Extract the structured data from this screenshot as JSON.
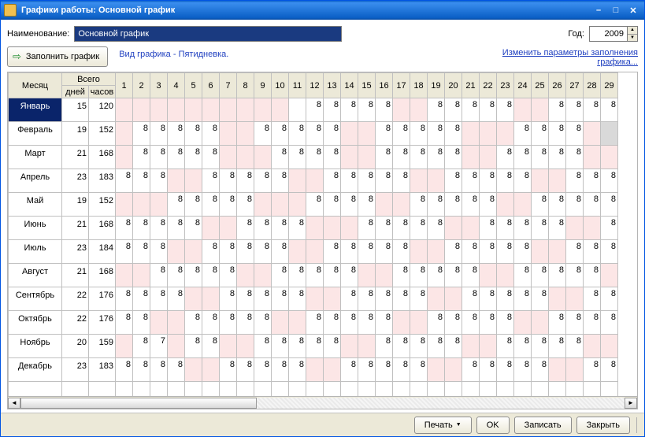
{
  "window": {
    "title": "Графики работы: Основной график"
  },
  "labels": {
    "name": "Наименование:",
    "year": "Год:",
    "fill": "Заполнить график",
    "schedule_type": "Вид графика - Пятидневка.",
    "edit_link": "Изменить параметры заполнения графика...",
    "month_header": "Месяц",
    "total_header": "Всего",
    "days_header": "дней",
    "hours_header": "часов"
  },
  "form": {
    "name_value": "Основной график",
    "year_value": "2009"
  },
  "day_headers": [
    "1",
    "2",
    "3",
    "4",
    "5",
    "6",
    "7",
    "8",
    "9",
    "10",
    "11",
    "12",
    "13",
    "14",
    "15",
    "16",
    "17",
    "18",
    "19",
    "20",
    "21",
    "22",
    "23",
    "24",
    "25",
    "26",
    "27",
    "28",
    "29"
  ],
  "months": [
    {
      "name": "Январь",
      "days": "15",
      "hours": "120",
      "cells": [
        "off",
        "off",
        "off",
        "off",
        "off",
        "off",
        "off",
        "off",
        "off",
        "off",
        "",
        "8",
        "8",
        "8",
        "8",
        "8",
        "off",
        "off",
        "8",
        "8",
        "8",
        "8",
        "8",
        "off",
        "off",
        "8",
        "8",
        "8",
        "8"
      ]
    },
    {
      "name": "Февраль",
      "days": "19",
      "hours": "152",
      "cells": [
        "off",
        "8",
        "8",
        "8",
        "8",
        "8",
        "off",
        "off",
        "8",
        "8",
        "8",
        "8",
        "8",
        "off",
        "off",
        "8",
        "8",
        "8",
        "8",
        "8",
        "off",
        "off",
        "off",
        "8",
        "8",
        "8",
        "8",
        "off",
        "end"
      ]
    },
    {
      "name": "Март",
      "days": "21",
      "hours": "168",
      "cells": [
        "off",
        "8",
        "8",
        "8",
        "8",
        "8",
        "off",
        "off",
        "off",
        "8",
        "8",
        "8",
        "8",
        "off",
        "off",
        "8",
        "8",
        "8",
        "8",
        "8",
        "off",
        "off",
        "8",
        "8",
        "8",
        "8",
        "8",
        "off",
        "off"
      ]
    },
    {
      "name": "Апрель",
      "days": "23",
      "hours": "183",
      "cells": [
        "8",
        "8",
        "8",
        "off",
        "off",
        "8",
        "8",
        "8",
        "8",
        "8",
        "off",
        "off",
        "8",
        "8",
        "8",
        "8",
        "8",
        "off",
        "off",
        "8",
        "8",
        "8",
        "8",
        "8",
        "off",
        "off",
        "8",
        "8",
        "8"
      ]
    },
    {
      "name": "Май",
      "days": "19",
      "hours": "152",
      "cells": [
        "off",
        "off",
        "off",
        "8",
        "8",
        "8",
        "8",
        "8",
        "off",
        "off",
        "off",
        "8",
        "8",
        "8",
        "8",
        "off",
        "off",
        "8",
        "8",
        "8",
        "8",
        "8",
        "off",
        "off",
        "8",
        "8",
        "8",
        "8",
        "8"
      ]
    },
    {
      "name": "Июнь",
      "days": "21",
      "hours": "168",
      "cells": [
        "8",
        "8",
        "8",
        "8",
        "8",
        "off",
        "off",
        "8",
        "8",
        "8",
        "8",
        "off",
        "off",
        "off",
        "8",
        "8",
        "8",
        "8",
        "8",
        "off",
        "off",
        "8",
        "8",
        "8",
        "8",
        "8",
        "off",
        "off",
        "8"
      ]
    },
    {
      "name": "Июль",
      "days": "23",
      "hours": "184",
      "cells": [
        "8",
        "8",
        "8",
        "off",
        "off",
        "8",
        "8",
        "8",
        "8",
        "8",
        "off",
        "off",
        "8",
        "8",
        "8",
        "8",
        "8",
        "off",
        "off",
        "8",
        "8",
        "8",
        "8",
        "8",
        "off",
        "off",
        "8",
        "8",
        "8"
      ]
    },
    {
      "name": "Август",
      "days": "21",
      "hours": "168",
      "cells": [
        "off",
        "off",
        "8",
        "8",
        "8",
        "8",
        "8",
        "off",
        "off",
        "8",
        "8",
        "8",
        "8",
        "8",
        "off",
        "off",
        "8",
        "8",
        "8",
        "8",
        "8",
        "off",
        "off",
        "8",
        "8",
        "8",
        "8",
        "8",
        "off"
      ]
    },
    {
      "name": "Сентябрь",
      "days": "22",
      "hours": "176",
      "cells": [
        "8",
        "8",
        "8",
        "8",
        "off",
        "off",
        "8",
        "8",
        "8",
        "8",
        "8",
        "off",
        "off",
        "8",
        "8",
        "8",
        "8",
        "8",
        "off",
        "off",
        "8",
        "8",
        "8",
        "8",
        "8",
        "off",
        "off",
        "8",
        "8"
      ]
    },
    {
      "name": "Октябрь",
      "days": "22",
      "hours": "176",
      "cells": [
        "8",
        "8",
        "off",
        "off",
        "8",
        "8",
        "8",
        "8",
        "8",
        "off",
        "off",
        "8",
        "8",
        "8",
        "8",
        "8",
        "off",
        "off",
        "8",
        "8",
        "8",
        "8",
        "8",
        "off",
        "off",
        "8",
        "8",
        "8",
        "8"
      ]
    },
    {
      "name": "Ноябрь",
      "days": "20",
      "hours": "159",
      "cells": [
        "off",
        "8",
        "7",
        "off",
        "8",
        "8",
        "off",
        "off",
        "8",
        "8",
        "8",
        "8",
        "8",
        "off",
        "off",
        "8",
        "8",
        "8",
        "8",
        "8",
        "off",
        "off",
        "8",
        "8",
        "8",
        "8",
        "8",
        "off",
        "off"
      ]
    },
    {
      "name": "Декабрь",
      "days": "23",
      "hours": "183",
      "cells": [
        "8",
        "8",
        "8",
        "8",
        "off",
        "off",
        "8",
        "8",
        "8",
        "8",
        "8",
        "off",
        "off",
        "8",
        "8",
        "8",
        "8",
        "8",
        "off",
        "off",
        "8",
        "8",
        "8",
        "8",
        "8",
        "off",
        "off",
        "8",
        "8"
      ]
    }
  ],
  "footer": {
    "print": "Печать",
    "ok": "OK",
    "save": "Записать",
    "close": "Закрыть"
  }
}
